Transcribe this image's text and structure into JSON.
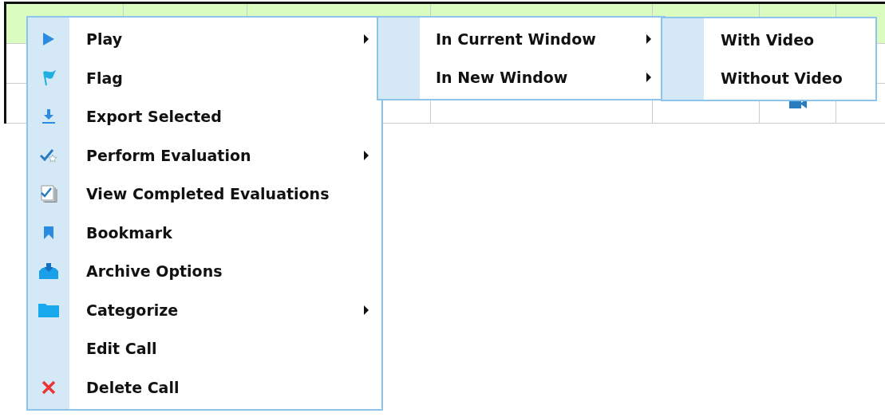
{
  "table": {
    "rows": [
      {
        "selected": true
      },
      {
        "selected": false
      },
      {
        "selected": false,
        "has_video": true
      }
    ]
  },
  "context_menu": {
    "items": [
      {
        "label": "Play",
        "kind": "play",
        "submenu": true,
        "children": [
          {
            "label": "In Current Window",
            "submenu": true,
            "children": [
              {
                "label": "With Video",
                "submenu": false
              },
              {
                "label": "Without Video",
                "submenu": false
              }
            ]
          },
          {
            "label": "In New Window",
            "submenu": true
          }
        ]
      },
      {
        "label": "Flag",
        "kind": "flag",
        "submenu": false
      },
      {
        "label": "Export Selected",
        "kind": "export",
        "submenu": false
      },
      {
        "label": "Perform Evaluation",
        "kind": "evaluate",
        "submenu": true
      },
      {
        "label": "View Completed Evaluations",
        "kind": "completed",
        "submenu": false
      },
      {
        "label": "Bookmark",
        "kind": "bookmark",
        "submenu": false
      },
      {
        "label": "Archive Options",
        "kind": "archive",
        "submenu": false
      },
      {
        "label": "Categorize",
        "kind": "folder",
        "submenu": true
      },
      {
        "label": "Edit Call",
        "kind": "plain",
        "submenu": false
      },
      {
        "label": "Delete Call",
        "kind": "delete",
        "submenu": false
      }
    ]
  }
}
